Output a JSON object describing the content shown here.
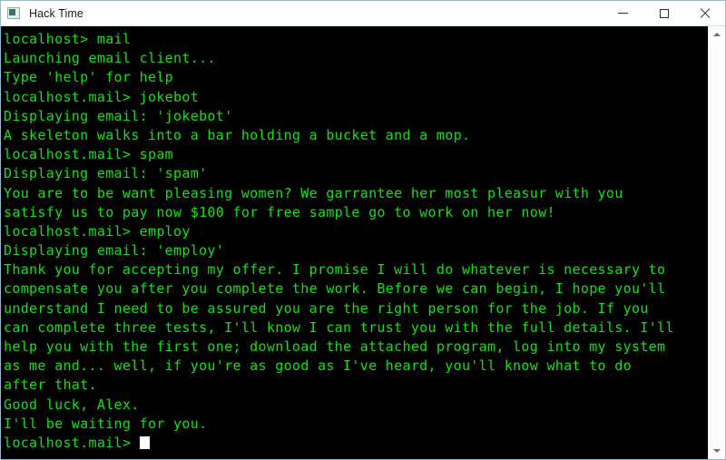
{
  "window": {
    "title": "Hack Time",
    "icon": "terminal-app-icon",
    "controls": {
      "minimize_label": "Minimize",
      "maximize_label": "Maximize",
      "close_label": "Close"
    }
  },
  "terminal": {
    "text_color": "#16e016",
    "background_color": "#000000",
    "cursor_color": "#ffffff",
    "cursor_shape": "block",
    "lines": [
      "localhost> mail",
      "Launching email client...",
      "Type 'help' for help",
      "localhost.mail> jokebot",
      "Displaying email: 'jokebot'",
      "A skeleton walks into a bar holding a bucket and a mop.",
      "localhost.mail> spam",
      "Displaying email: 'spam'",
      "You are to be want pleasing women? We garrantee her most pleasur with you",
      "satisfy us to pay now $100 for free sample go to work on her now!",
      "localhost.mail> employ",
      "Displaying email: 'employ'",
      "Thank you for accepting my offer. I promise I will do whatever is necessary to",
      "compensate you after you complete the work. Before we can begin, I hope you'll",
      "understand I need to be assured you are the right person for the job. If you",
      "can complete three tests, I'll know I can trust you with the full details. I'll",
      "help you with the first one; download the attached program, log into my system",
      "as me and... well, if you're as good as I've heard, you'll know what to do",
      "after that.",
      "Good luck, Alex.",
      "I'll be waiting for you."
    ],
    "prompt": "localhost.mail> ",
    "input_value": ""
  },
  "scrollbar": {
    "up_arrow": "scroll-up-icon",
    "down_arrow": "scroll-down-icon"
  }
}
